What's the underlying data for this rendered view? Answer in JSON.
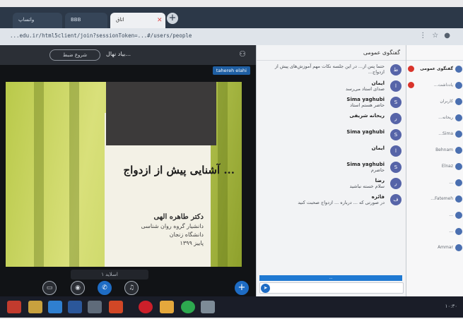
{
  "browser": {
    "tabs": [
      {
        "label": "واتساپ"
      },
      {
        "label": "BBB"
      },
      {
        "label": "اتاق"
      }
    ],
    "new_tab_symbol": "+",
    "url": "...edu.ir/html5client/join?sessionToken=...#/users/people",
    "icons": [
      "menu-icon",
      "star-icon",
      "profile-icon"
    ]
  },
  "stage": {
    "record_label": "شروع ضبط",
    "room_title": "بیاد نهال...",
    "presenter_name": "tahereh elahi",
    "slide": {
      "title": "... آشنایی پیش از ازدواج",
      "author_name": "دکتر طاهره الهی",
      "author_lines": [
        "دانشیار گروه روان شناسی",
        "دانشگاه زنجان",
        "پاییز ۱۳۹۹"
      ]
    },
    "slide_nav_label": "اسلاید ۱",
    "controls": [
      "share-screen-icon",
      "video-icon",
      "phone-icon",
      "mic-icon"
    ],
    "plus_symbol": "+"
  },
  "chat": {
    "header": "گفتگوی عمومی",
    "messages": [
      {
        "initial": "ط",
        "sender": "",
        "text": "حتما پس از... در این جلسه نکات مهم آموزش‌های پیش از ازدواج..."
      },
      {
        "initial": "ا",
        "sender": "ایمان",
        "text": "صدای استاد می‌رسد"
      },
      {
        "initial": "S",
        "sender": "Sima yaghubi",
        "text": "حاضر هستم استاد"
      },
      {
        "initial": "ر",
        "sender": "ریحانه شریفی",
        "text": ""
      },
      {
        "initial": "S",
        "sender": "Sima yaghubi",
        "text": ""
      },
      {
        "initial": "ا",
        "sender": "ایمان",
        "text": ""
      },
      {
        "initial": "S",
        "sender": "Sima yaghubi",
        "text": "حاضرم"
      },
      {
        "initial": "ر",
        "sender": "رضا",
        "text": "سلام خسته نباشید"
      },
      {
        "initial": "ف",
        "sender": "فائزه",
        "text": "در صورتی که ... درباره ... ازدواج صحبت کنید"
      }
    ],
    "banner": "...",
    "send_icon": "send-icon"
  },
  "users_panel": {
    "items": [
      {
        "label": "گفتگوی عمومی",
        "badge": true,
        "public": true
      },
      {
        "label": "یادداشت...",
        "badge": true,
        "public": false
      },
      {
        "label": "کاربران",
        "badge": false,
        "public": false
      },
      {
        "label": "ریحانه...",
        "badge": false,
        "public": false
      },
      {
        "label": "Sima...",
        "badge": false,
        "public": false
      },
      {
        "label": "Behnam",
        "badge": false,
        "public": false
      },
      {
        "label": "Elnaz",
        "badge": false,
        "public": false
      },
      {
        "label": "...",
        "badge": false,
        "public": false
      },
      {
        "label": "Fatemeh...",
        "badge": false,
        "public": false
      },
      {
        "label": "...",
        "badge": false,
        "public": false
      },
      {
        "label": "...",
        "badge": false,
        "public": false
      },
      {
        "label": "Ammar",
        "badge": false,
        "public": false
      }
    ]
  },
  "taskbar": {
    "tray_text": "۱۰:۳۰"
  },
  "colors": {
    "accent": "#1e6cc4",
    "slide_green": "#b9c94a",
    "alert_red": "#d9342b"
  }
}
